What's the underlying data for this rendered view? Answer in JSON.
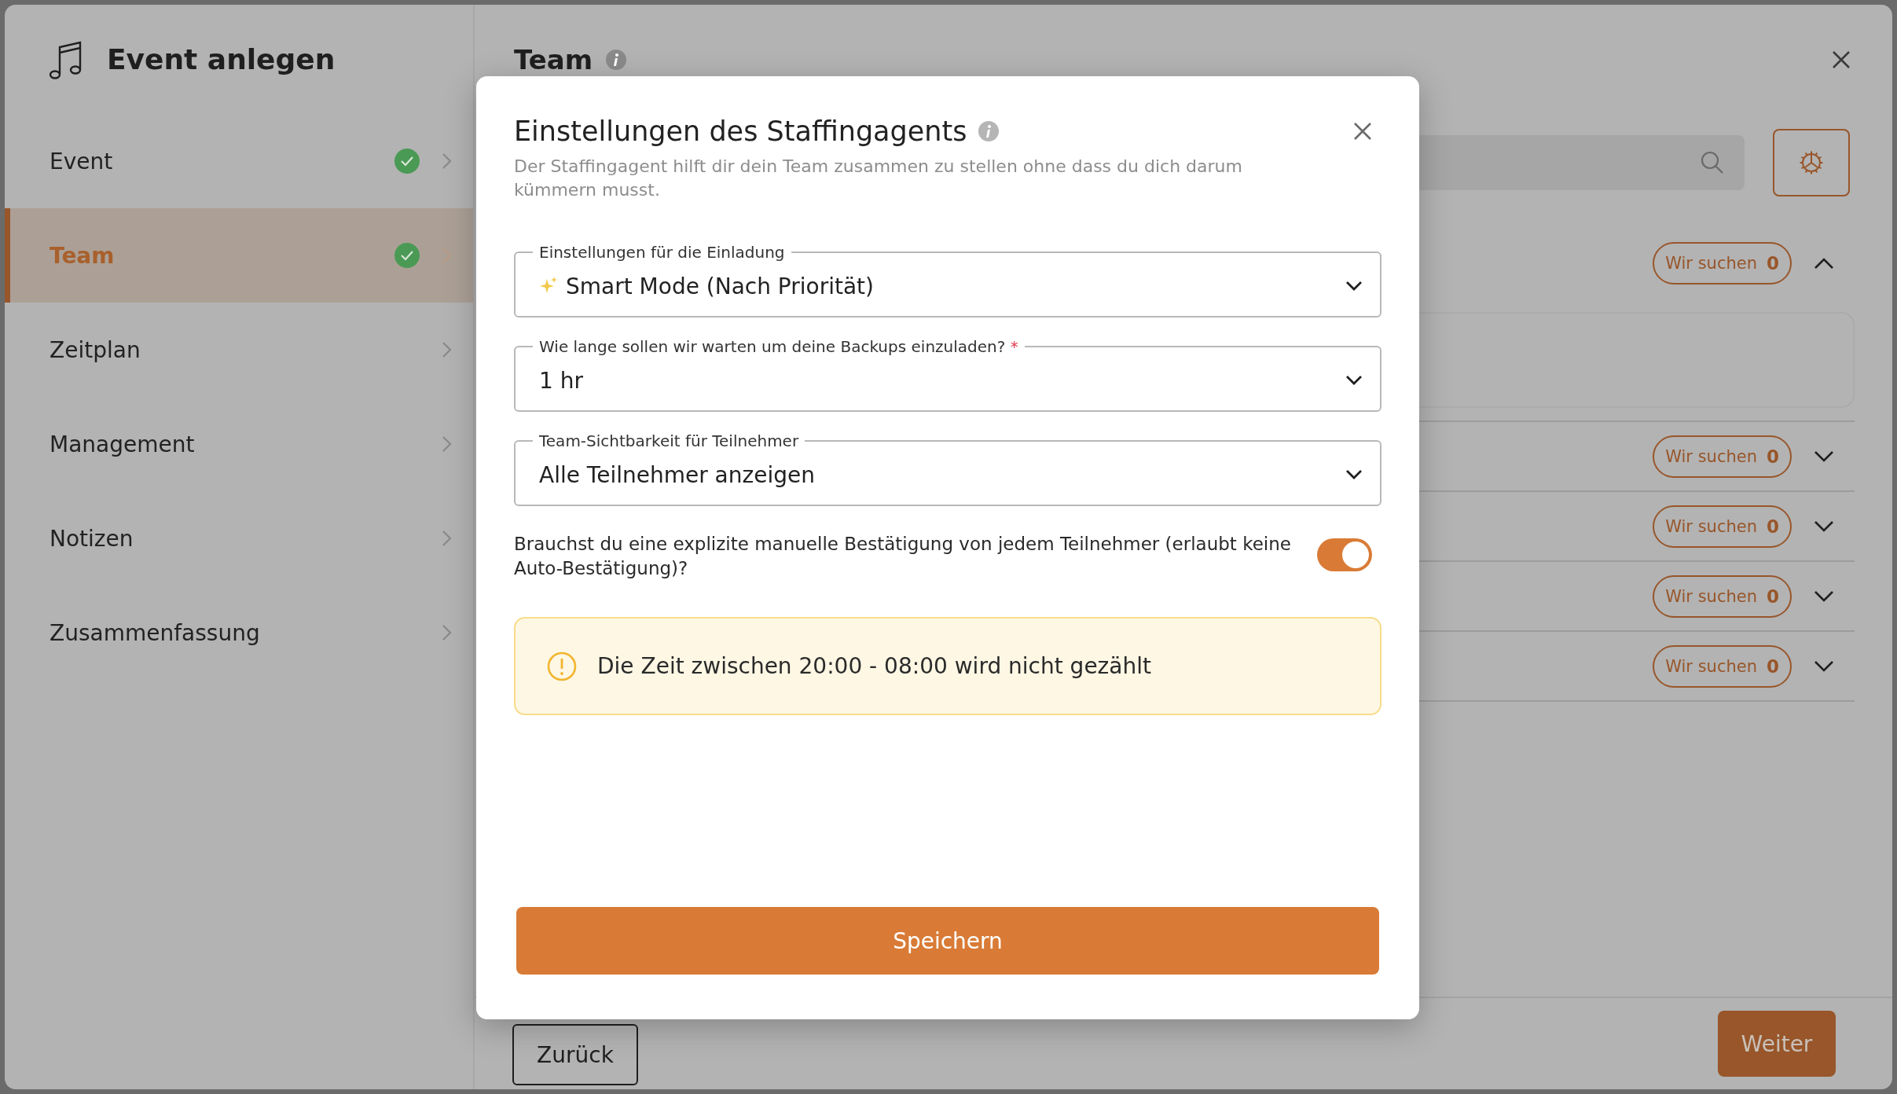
{
  "sidebar": {
    "title": "Event anlegen",
    "items": [
      {
        "label": "Event",
        "done": true,
        "selected": false
      },
      {
        "label": "Team",
        "done": true,
        "selected": true
      },
      {
        "label": "Zeitplan",
        "done": false,
        "selected": false
      },
      {
        "label": "Management",
        "done": false,
        "selected": false
      },
      {
        "label": "Notizen",
        "done": false,
        "selected": false
      },
      {
        "label": "Zusammenfassung",
        "done": false,
        "selected": false
      }
    ]
  },
  "main": {
    "title": "Team",
    "rows": [
      {
        "badge_label": "Wir suchen",
        "badge_count": "0",
        "expanded": true
      },
      {
        "badge_label": "Wir suchen",
        "badge_count": "0",
        "expanded": false
      },
      {
        "badge_label": "Wir suchen",
        "badge_count": "0",
        "expanded": false
      },
      {
        "badge_label": "Wir suchen",
        "badge_count": "0",
        "expanded": false
      },
      {
        "badge_label": "Wir suchen",
        "badge_count": "0",
        "expanded": false
      }
    ],
    "footer": {
      "back": "Zurück",
      "next": "Weiter"
    }
  },
  "modal": {
    "title": "Einstellungen des Staffingagents",
    "description": "Der Staffingagent hilft dir dein Team zusammen zu stellen ohne dass du dich darum kümmern musst.",
    "fields": [
      {
        "label": "Einstellungen für die Einladung",
        "value": "Smart Mode (Nach Priorität)",
        "sparkle": true
      },
      {
        "label": "Wie lange sollen wir warten um deine Backups einzuladen?",
        "required_mark": "*",
        "value": "1 hr"
      },
      {
        "label": "Team-Sichtbarkeit für Teilnehmer",
        "value": "Alle Teilnehmer anzeigen"
      }
    ],
    "toggle": {
      "label": "Brauchst du eine explizite manuelle Bestätigung von jedem Teilnehmer (erlaubt keine Auto-Bestätigung)?",
      "on": true
    },
    "notice": "Die Zeit zwischen 20:00 - 08:00 wird nicht gezählt",
    "save": "Speichern"
  }
}
